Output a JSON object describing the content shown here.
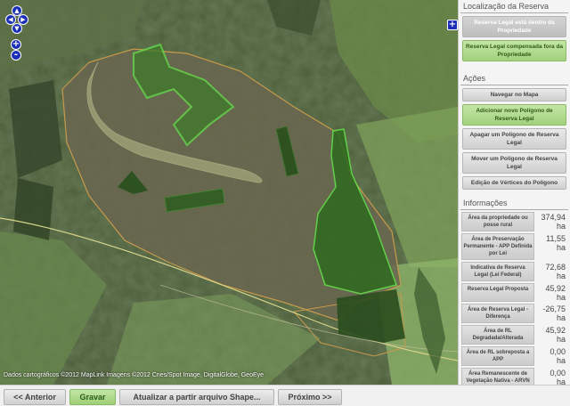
{
  "map": {
    "attribution": "Dados cartográficos ©2012 MapLink Imagens ©2012 Cnes/Spot Image, DigitalGlobe, GeoEye",
    "controls": {
      "pan_up": "▲",
      "pan_left": "◀",
      "pan_right": "▶",
      "pan_down": "▼",
      "zoom_in": "+",
      "zoom_out": "-",
      "layers": "+"
    }
  },
  "sidebar": {
    "location_title": "Localização da Reserva",
    "location_buttons": [
      "Reserva Legal está dentro da Propriedade",
      "Reserva Legal compensada fora da Propriedade"
    ],
    "actions_title": "Ações",
    "action_buttons": [
      "Navegar no Mapa",
      "Adicionar novo Polígono de Reserva Legal",
      "Apagar um Polígono de Reserva Legal",
      "Mover um Polígono de Reserva Legal",
      "Edição de Vértices do Polígono"
    ],
    "info_title": "Informações",
    "info_rows": [
      {
        "label": "Área da propriedade ou posse rural",
        "value": "374,94",
        "unit": "ha"
      },
      {
        "label": "Área de Preservação Permanente - APP Definida por Lei",
        "value": "11,55",
        "unit": "ha"
      },
      {
        "label": "Indicativa de Reserva Legal (Lei Federal)",
        "value": "72,68",
        "unit": "ha"
      },
      {
        "label": "Reserva Legal Proposta",
        "value": "45,92",
        "unit": "ha"
      },
      {
        "label": "Área de Reserva Legal - Diferença",
        "value": "-26,75",
        "unit": "ha"
      },
      {
        "label": "Área de RL Degradada/Alterada",
        "value": "45,92",
        "unit": "ha"
      },
      {
        "label": "Área de RL sobreposta a APP",
        "value": "0,00",
        "unit": "ha"
      },
      {
        "label": "Área Remanescente de Vegetação Nativa - ARVN (Vegetação Natural além da APP e RL)",
        "value": "0,00",
        "unit": "ha"
      }
    ]
  },
  "toolbar": {
    "prev": "<< Anterior",
    "save": "Gravar",
    "update_shape": "Atualizar a partir arquivo Shape...",
    "next": "Próximo >>"
  }
}
